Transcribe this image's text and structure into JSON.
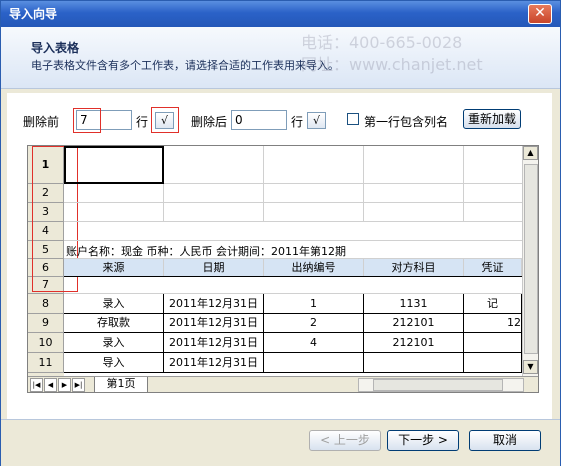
{
  "window": {
    "title": "导入向导",
    "close_glyph": "✕"
  },
  "header": {
    "title": "导入表格",
    "description": "电子表格文件含有多个工作表，请选择合适的工作表用来导入。"
  },
  "toolbar": {
    "delete_before_label": "删除前",
    "delete_before_value": "7",
    "rows_label_1": "行",
    "apply_glyph_1": "√",
    "delete_after_label": "删除后",
    "delete_after_value": "0",
    "rows_label_2": "行",
    "apply_glyph_2": "√",
    "first_row_header_label": "第一行包含列名",
    "first_row_header_checked": false,
    "reload_label": "重新加载"
  },
  "grid": {
    "row_numbers": [
      "1",
      "2",
      "3",
      "4",
      "5",
      "6",
      "7",
      "8",
      "9",
      "10",
      "11"
    ],
    "info_row": "账户名称：现金  币种：人民币   会计期间：2011年第12期",
    "columns": [
      "来源",
      "日期",
      "出纳编号",
      "对方科目",
      "凭证"
    ],
    "rows": [
      [
        "录入",
        "2011年12月31日",
        "1",
        "1131",
        "记"
      ],
      [
        "存取款",
        "2011年12月31日",
        "2",
        "212101",
        "12"
      ],
      [
        "录入",
        "2011年12月31日",
        "4",
        "212101",
        ""
      ],
      [
        "导入",
        "2011年12月31日",
        "",
        "",
        ""
      ]
    ],
    "sheet_tab": "第1页"
  },
  "footer": {
    "prev_label": "< 上一步",
    "next_label": "下一步 >",
    "cancel_label": "取消"
  },
  "watermark": {
    "phone": "电话：400-665-0028",
    "site": "网址：www.chanjet.net"
  },
  "colors": {
    "title_bar": "#2b62c8",
    "highlight_box": "#e0302a",
    "header_row": "#d6e4f4"
  }
}
